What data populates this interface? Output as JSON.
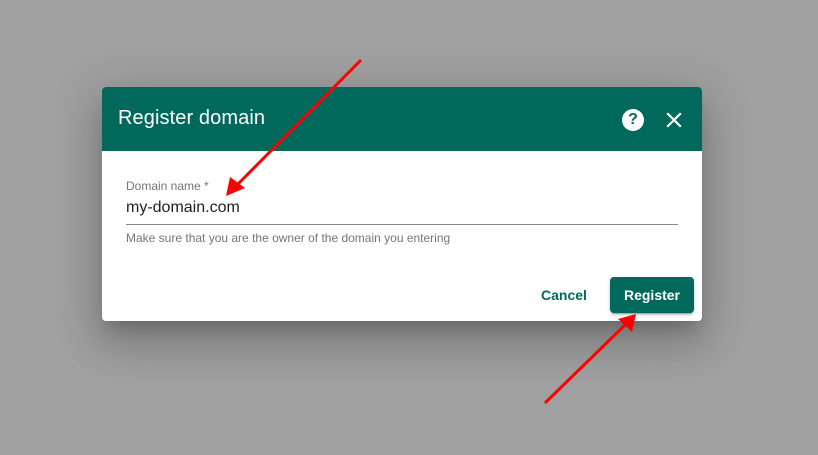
{
  "dialog": {
    "title": "Register domain",
    "help_icon_glyph": "?",
    "close_icon": "close-icon",
    "help_icon": "help-icon"
  },
  "form": {
    "domain_label": "Domain name *",
    "domain_value": "my-domain.com",
    "domain_hint": "Make sure that you are the owner of the domain you entering"
  },
  "actions": {
    "cancel_label": "Cancel",
    "register_label": "Register"
  },
  "colors": {
    "primary": "#00695c",
    "backdrop": "#a0a0a0",
    "annotation_arrow": "#ff0000"
  }
}
